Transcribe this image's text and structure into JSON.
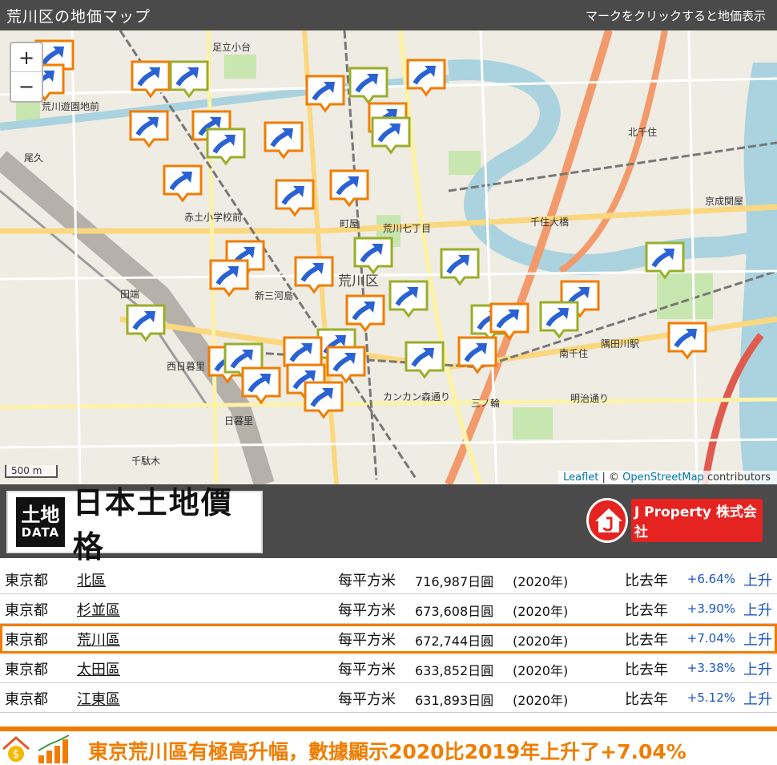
{
  "header": {
    "title": "荒川区の地価マップ",
    "hint": "マークをクリックすると地価表示"
  },
  "map": {
    "zoom_in": "+",
    "zoom_out": "−",
    "scale": "500 m",
    "attribution_leaflet": "Leaflet",
    "attribution_sep": " | © ",
    "attribution_osm": "OpenStreetMap",
    "attribution_tail": " contributors",
    "labels": [
      "足立小台",
      "荒川遊園地前",
      "北千住",
      "尾久",
      "赤土小学校前",
      "町屋",
      "荒川七丁目",
      "千住大橋",
      "京成関屋",
      "荒川区",
      "新三河島",
      "田端",
      "西日暮里",
      "日暮里",
      "南千住",
      "三ノ輪",
      "千駄木",
      "カンカン森通り",
      "隅田川駅",
      "明治通り"
    ],
    "marker_colors": {
      "orange": "#f07d00",
      "olive": "#9aae2a",
      "arrow": "#2a62d4"
    }
  },
  "banner": {
    "logo_kanji": "土地",
    "logo_data": "DATA",
    "logo_text": "日本土地價格",
    "company": "J Property 株式会社"
  },
  "table": {
    "rows": [
      {
        "pref": "東京都",
        "ward": "北區",
        "unit": "每平方米",
        "price": "716,987日圓",
        "year": "(2020年)",
        "cmp": "比去年",
        "pct": "+6.64%",
        "dir": "上升"
      },
      {
        "pref": "東京都",
        "ward": "杉並區",
        "unit": "每平方米",
        "price": "673,608日圓",
        "year": "(2020年)",
        "cmp": "比去年",
        "pct": "+3.90%",
        "dir": "上升"
      },
      {
        "pref": "東京都",
        "ward": "荒川區",
        "unit": "每平方米",
        "price": "672,744日圓",
        "year": "(2020年)",
        "cmp": "比去年",
        "pct": "+7.04%",
        "dir": "上升"
      },
      {
        "pref": "東京都",
        "ward": "太田區",
        "unit": "每平方米",
        "price": "633,852日圓",
        "year": "(2020年)",
        "cmp": "比去年",
        "pct": "+3.38%",
        "dir": "上升"
      },
      {
        "pref": "東京都",
        "ward": "江東區",
        "unit": "每平方米",
        "price": "631,893日圓",
        "year": "(2020年)",
        "cmp": "比去年",
        "pct": "+5.12%",
        "dir": "上升"
      }
    ]
  },
  "footer": {
    "message": "東京荒川區有極高升幅，數據顯示2020比2019年上升了+7.04%"
  }
}
